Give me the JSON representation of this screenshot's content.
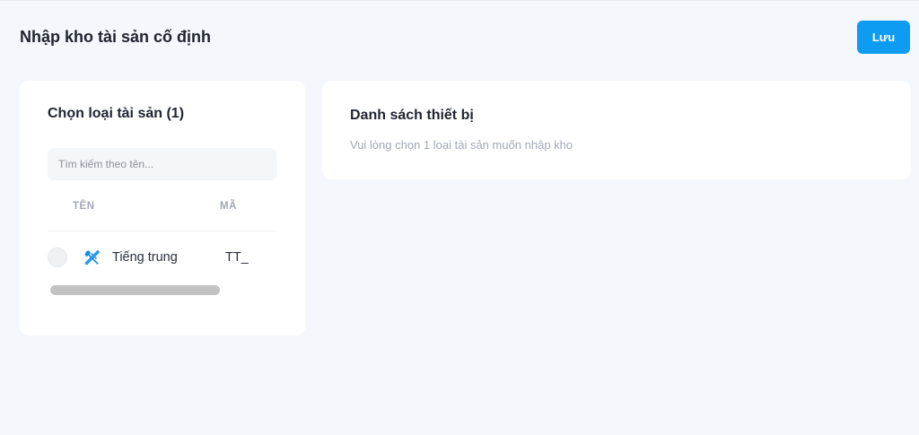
{
  "header": {
    "title": "Nhập kho tài sản cố định",
    "save_label": "Lưu"
  },
  "asset_type_panel": {
    "title": "Chọn loại tài sản (1)",
    "search_placeholder": "Tìm kiếm theo tên...",
    "columns": {
      "name": "TÊN",
      "code": "MÃ"
    },
    "rows": [
      {
        "icon": "tools-icon",
        "name": "Tiếng trung",
        "code": "TT_"
      }
    ]
  },
  "device_list_panel": {
    "title": "Danh sách thiết bị",
    "hint": "Vui lòng chọn 1 loại tài sản muốn nhập kho"
  },
  "colors": {
    "accent": "#0d9cf2",
    "background": "#f4f7fb"
  }
}
